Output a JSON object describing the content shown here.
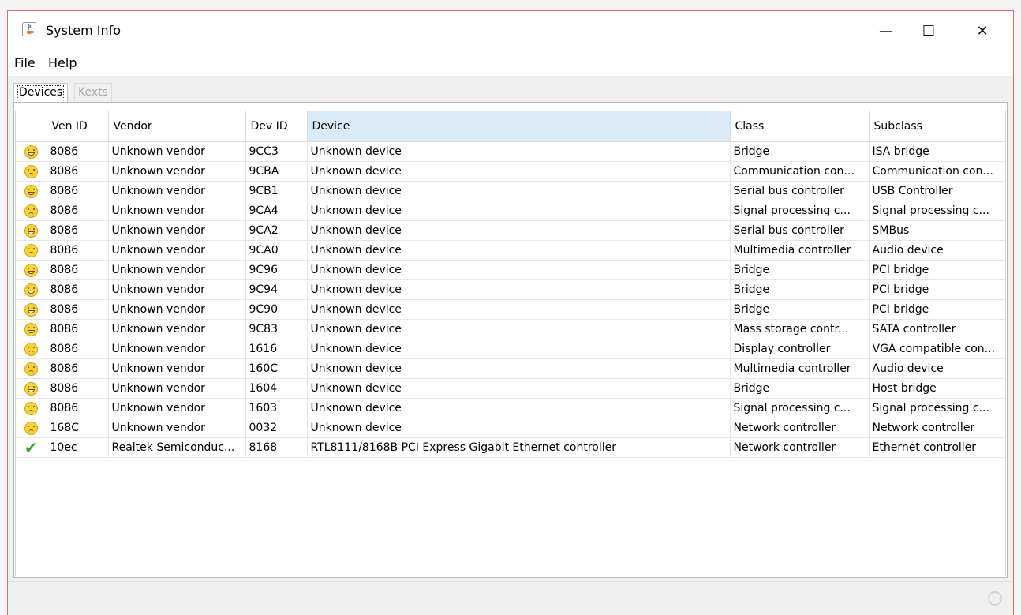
{
  "window": {
    "title": "System Info",
    "icon": "java-app-icon",
    "controls": {
      "minimize": "—",
      "maximize": "☐",
      "close": "✕"
    }
  },
  "menu": [
    "File",
    "Help"
  ],
  "tabs": [
    {
      "label": "Devices",
      "state": "active"
    },
    {
      "label": "Kexts",
      "state": "disabled"
    }
  ],
  "table": {
    "columns": [
      "",
      "Ven ID",
      "Vendor",
      "Dev ID",
      "Device",
      "Class",
      "Subclass"
    ],
    "selected_column": "Device",
    "rows": [
      {
        "status": "happy",
        "ven_id": "8086",
        "vendor": "Unknown vendor",
        "dev_id": "9CC3",
        "device": "Unknown device",
        "class": "Bridge",
        "subclass": "ISA bridge"
      },
      {
        "status": "sad",
        "ven_id": "8086",
        "vendor": "Unknown vendor",
        "dev_id": "9CBA",
        "device": "Unknown device",
        "class": "Communication con...",
        "subclass": "Communication con..."
      },
      {
        "status": "happy",
        "ven_id": "8086",
        "vendor": "Unknown vendor",
        "dev_id": "9CB1",
        "device": "Unknown device",
        "class": "Serial bus controller",
        "subclass": "USB Controller"
      },
      {
        "status": "sad",
        "ven_id": "8086",
        "vendor": "Unknown vendor",
        "dev_id": "9CA4",
        "device": "Unknown device",
        "class": "Signal processing c...",
        "subclass": "Signal processing c..."
      },
      {
        "status": "happy",
        "ven_id": "8086",
        "vendor": "Unknown vendor",
        "dev_id": "9CA2",
        "device": "Unknown device",
        "class": "Serial bus controller",
        "subclass": "SMBus"
      },
      {
        "status": "sad",
        "ven_id": "8086",
        "vendor": "Unknown vendor",
        "dev_id": "9CA0",
        "device": "Unknown device",
        "class": "Multimedia controller",
        "subclass": "Audio device"
      },
      {
        "status": "happy",
        "ven_id": "8086",
        "vendor": "Unknown vendor",
        "dev_id": "9C96",
        "device": "Unknown device",
        "class": "Bridge",
        "subclass": "PCI bridge"
      },
      {
        "status": "happy",
        "ven_id": "8086",
        "vendor": "Unknown vendor",
        "dev_id": "9C94",
        "device": "Unknown device",
        "class": "Bridge",
        "subclass": "PCI bridge"
      },
      {
        "status": "happy",
        "ven_id": "8086",
        "vendor": "Unknown vendor",
        "dev_id": "9C90",
        "device": "Unknown device",
        "class": "Bridge",
        "subclass": "PCI bridge"
      },
      {
        "status": "happy",
        "ven_id": "8086",
        "vendor": "Unknown vendor",
        "dev_id": "9C83",
        "device": "Unknown device",
        "class": "Mass storage contr...",
        "subclass": "SATA controller"
      },
      {
        "status": "sad",
        "ven_id": "8086",
        "vendor": "Unknown vendor",
        "dev_id": "1616",
        "device": "Unknown device",
        "class": "Display controller",
        "subclass": "VGA compatible con..."
      },
      {
        "status": "sad",
        "ven_id": "8086",
        "vendor": "Unknown vendor",
        "dev_id": "160C",
        "device": "Unknown device",
        "class": "Multimedia controller",
        "subclass": "Audio device"
      },
      {
        "status": "happy",
        "ven_id": "8086",
        "vendor": "Unknown vendor",
        "dev_id": "1604",
        "device": "Unknown device",
        "class": "Bridge",
        "subclass": "Host bridge"
      },
      {
        "status": "sad",
        "ven_id": "8086",
        "vendor": "Unknown vendor",
        "dev_id": "1603",
        "device": "Unknown device",
        "class": "Signal processing c...",
        "subclass": "Signal processing c..."
      },
      {
        "status": "sad",
        "ven_id": "168C",
        "vendor": "Unknown vendor",
        "dev_id": "0032",
        "device": "Unknown device",
        "class": "Network controller",
        "subclass": "Network controller"
      },
      {
        "status": "ok",
        "ven_id": "10ec",
        "vendor": "Realtek Semiconduc...",
        "dev_id": "8168",
        "device": "RTL8111/8168B PCI Express Gigabit Ethernet controller",
        "class": "Network controller",
        "subclass": "Ethernet controller"
      }
    ]
  },
  "status_icons": {
    "happy": "happy-face-icon",
    "sad": "sad-face-icon",
    "ok": "checkmark-icon"
  },
  "colors": {
    "selected_header": "#d9ebf9",
    "window_border": "#e06b6b",
    "check": "#3aa829",
    "face": "#f9d33a"
  }
}
